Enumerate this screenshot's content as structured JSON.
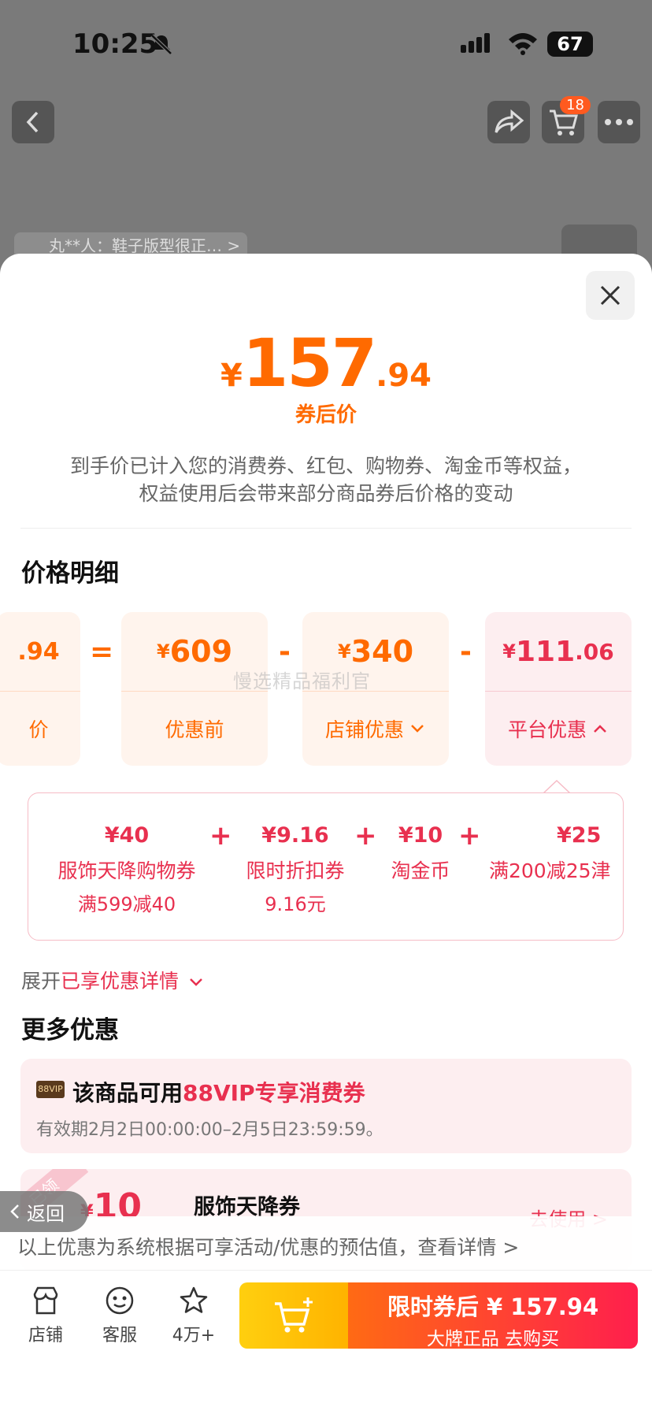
{
  "status": {
    "time": "10:25",
    "battery": "67"
  },
  "header": {
    "cart_count": "18",
    "review_chip": "丸**人：鞋子版型很正…  >"
  },
  "price": {
    "yen": "¥",
    "int": "157",
    "dec": ".94",
    "label": "券后价",
    "note_line1": "到手价已计入您的消费券、红包、购物券、淘金币等权益，",
    "note_line2": "权益使用后会带来部分商品券后价格的变动"
  },
  "breakdown": {
    "title": "价格明细",
    "cards": [
      {
        "val_small": "",
        "val_big": ".94",
        "label": "价"
      },
      {
        "val_small": "¥",
        "val_big": "609",
        "label": "优惠前"
      },
      {
        "val_small": "¥",
        "val_big": "340",
        "label": "店铺优惠"
      },
      {
        "val_small": "¥",
        "val_big": "111",
        "val_dec": ".06",
        "label": "平台优惠"
      }
    ],
    "ops": [
      "=",
      "-",
      "-"
    ]
  },
  "coupons": [
    {
      "amount": "¥40",
      "name": "服饰天降购物券",
      "sub": "满599减40"
    },
    {
      "amount": "¥9.16",
      "name": "限时折扣券",
      "sub": "9.16元"
    },
    {
      "amount": "¥10",
      "name": "淘金币",
      "sub": ""
    },
    {
      "amount": "¥25",
      "name": "满200减25津",
      "sub": ""
    }
  ],
  "plus": "+",
  "expand": {
    "prefix": "展开",
    "red": "已享优惠详情"
  },
  "more": {
    "title": "更多优惠",
    "vip_badge": "88VIP",
    "vip_prefix": "该商品可用",
    "vip_red": "88VIP专享消费券",
    "vip_sub": "有效期2月2日00:00:00–2月5日23:59:59。",
    "ribbon": "已领",
    "coupon_yen": "¥",
    "coupon_amt": "10",
    "coupon_name": "服饰天降券",
    "coupon_use": "去使用 >"
  },
  "watermark": "慢选精品福利官",
  "back_label": "返回",
  "bottom_note": "以上优惠为系统根据可享活动/优惠的预估值，查看详情 >",
  "footer": {
    "shop": "店铺",
    "service": "客服",
    "fav": "4万+",
    "buy_line1": "限时券后 ¥ 157.94",
    "buy_line2": "大牌正品  去购买"
  }
}
